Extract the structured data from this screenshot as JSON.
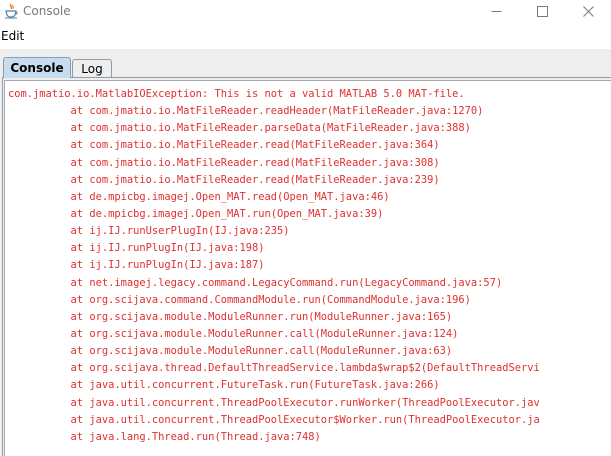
{
  "window": {
    "title": "Console"
  },
  "menu": {
    "items": [
      "Edit"
    ]
  },
  "tabs": [
    {
      "label": "Console",
      "selected": true
    },
    {
      "label": "Log",
      "selected": false
    }
  ],
  "colors": {
    "error_text": "#e03030",
    "tab_selected_bg": "#c8dcf0",
    "tab_border": "#8a9db1"
  },
  "console": {
    "lines": [
      "com.jmatio.io.MatlabIOException: This is not a valid MATLAB 5.0 MAT-file.",
      "          at com.jmatio.io.MatFileReader.readHeader(MatFileReader.java:1270)",
      "          at com.jmatio.io.MatFileReader.parseData(MatFileReader.java:388)",
      "          at com.jmatio.io.MatFileReader.read(MatFileReader.java:364)",
      "          at com.jmatio.io.MatFileReader.read(MatFileReader.java:308)",
      "          at com.jmatio.io.MatFileReader.read(MatFileReader.java:239)",
      "          at de.mpicbg.imagej.Open_MAT.read(Open_MAT.java:46)",
      "          at de.mpicbg.imagej.Open_MAT.run(Open_MAT.java:39)",
      "          at ij.IJ.runUserPlugIn(IJ.java:235)",
      "          at ij.IJ.runPlugIn(IJ.java:198)",
      "          at ij.IJ.runPlugIn(IJ.java:187)",
      "          at net.imagej.legacy.command.LegacyCommand.run(LegacyCommand.java:57)",
      "          at org.scijava.command.CommandModule.run(CommandModule.java:196)",
      "          at org.scijava.module.ModuleRunner.run(ModuleRunner.java:165)",
      "          at org.scijava.module.ModuleRunner.call(ModuleRunner.java:124)",
      "          at org.scijava.module.ModuleRunner.call(ModuleRunner.java:63)",
      "          at org.scijava.thread.DefaultThreadService.lambda$wrap$2(DefaultThreadServi",
      "          at java.util.concurrent.FutureTask.run(FutureTask.java:266)",
      "          at java.util.concurrent.ThreadPoolExecutor.runWorker(ThreadPoolExecutor.jav",
      "          at java.util.concurrent.ThreadPoolExecutor$Worker.run(ThreadPoolExecutor.ja",
      "          at java.lang.Thread.run(Thread.java:748)"
    ]
  }
}
